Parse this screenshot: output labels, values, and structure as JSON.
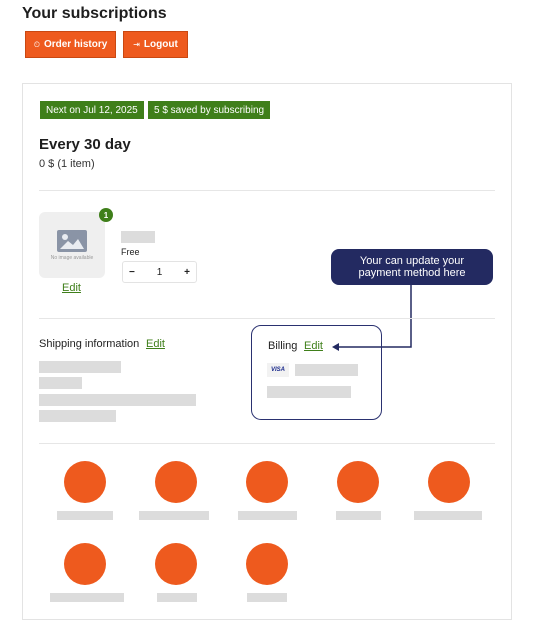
{
  "page": {
    "title": "Your subscriptions"
  },
  "buttons": {
    "order_history": {
      "label": "Order history",
      "icon": "history-icon",
      "glyph": "⏲"
    },
    "logout": {
      "label": "Logout",
      "icon": "logout-icon",
      "glyph": "⇥"
    }
  },
  "subscription": {
    "next_badge": "Next on Jul 12, 2025",
    "saved_badge": "5 $ saved by subscribing",
    "frequency": "Every 30 day",
    "total": "0 $ (1 item)",
    "item": {
      "quantity_badge": "1",
      "placeholder_text": "No image available",
      "edit_label": "Edit",
      "price": "Free",
      "quantity": "1",
      "decrement": "−",
      "increment": "+"
    },
    "tooltip": "Your can update your payment method here",
    "shipping": {
      "label": "Shipping information",
      "edit_label": "Edit"
    },
    "billing": {
      "label": "Billing",
      "edit_label": "Edit",
      "card_brand": "VISA"
    }
  },
  "colors": {
    "accent_orange": "#ee5a1e",
    "badge_green": "#3f7f1a",
    "tooltip_navy": "#232a61",
    "skeleton_gray": "#dcdcdc"
  }
}
